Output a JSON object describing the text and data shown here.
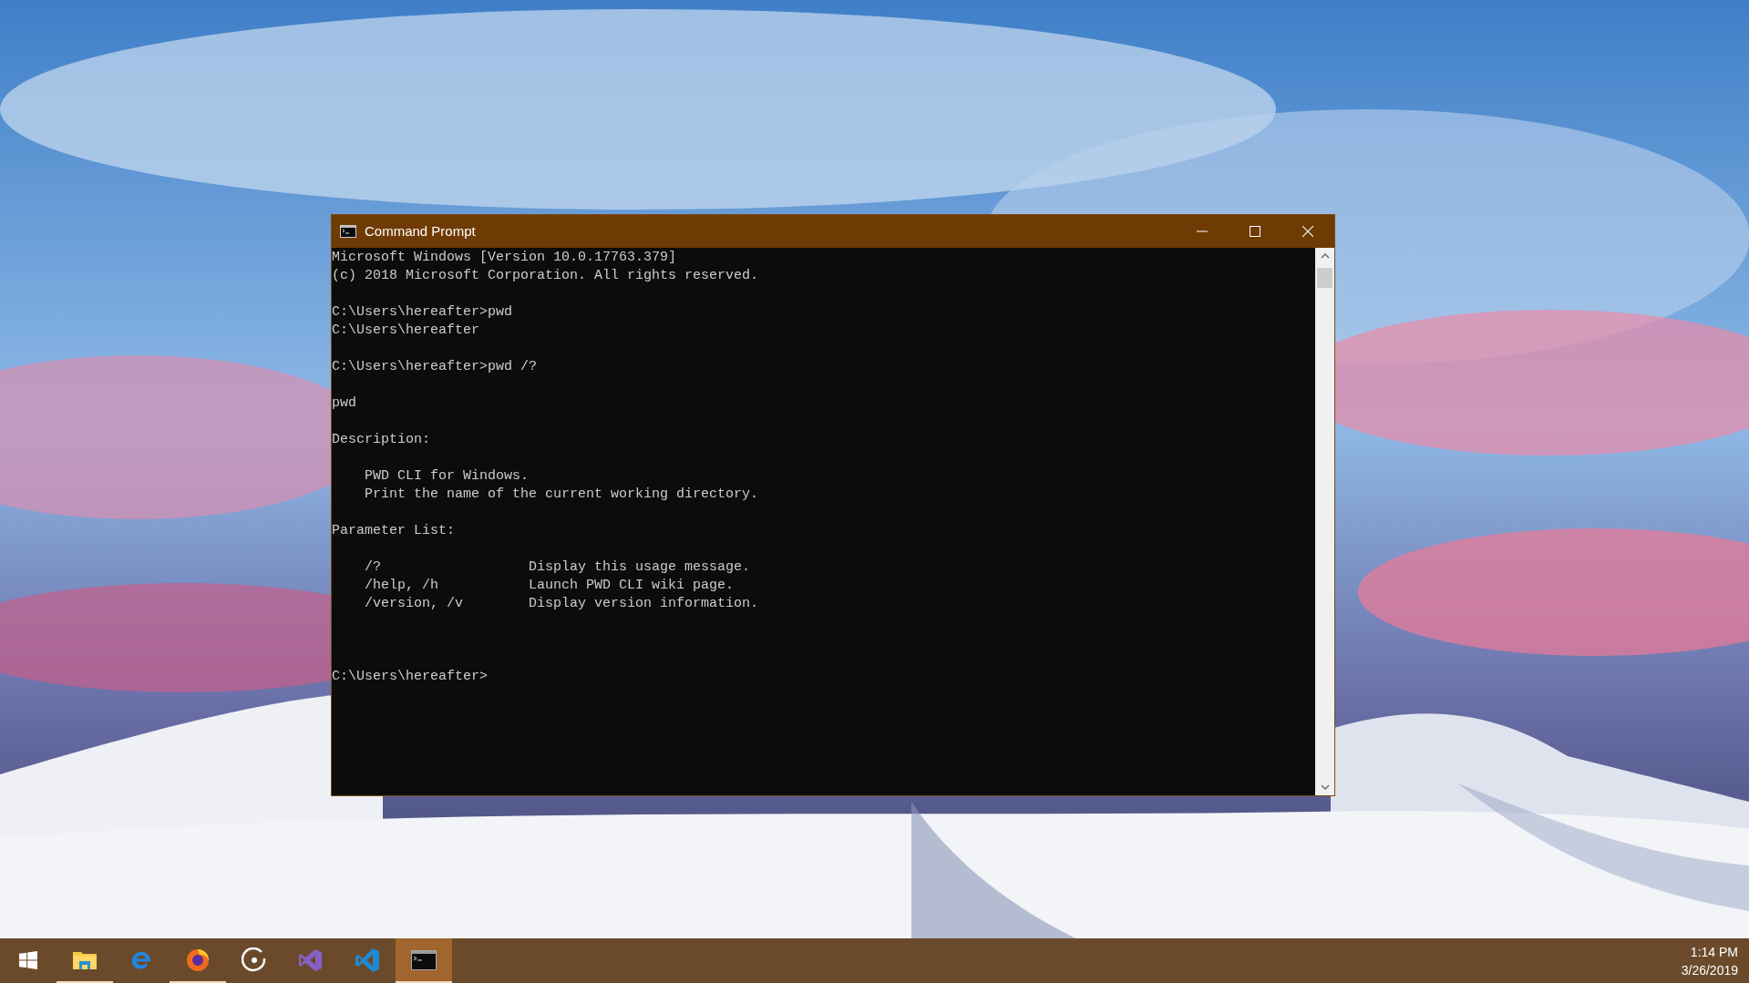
{
  "window": {
    "title": "Command Prompt",
    "active": true
  },
  "console": {
    "lines": [
      {
        "kind": "line",
        "text": "Microsoft Windows [Version 10.0.17763.379]"
      },
      {
        "kind": "line",
        "text": "(c) 2018 Microsoft Corporation. All rights reserved."
      },
      {
        "kind": "blank"
      },
      {
        "kind": "line",
        "text": "C:\\Users\\hereafter>pwd"
      },
      {
        "kind": "line",
        "text": "C:\\Users\\hereafter"
      },
      {
        "kind": "blank"
      },
      {
        "kind": "line",
        "text": "C:\\Users\\hereafter>pwd /?"
      },
      {
        "kind": "blank"
      },
      {
        "kind": "line",
        "text": "pwd"
      },
      {
        "kind": "blank"
      },
      {
        "kind": "line",
        "text": "Description:"
      },
      {
        "kind": "blank"
      },
      {
        "kind": "indented",
        "text": "PWD CLI for Windows."
      },
      {
        "kind": "indented",
        "text": "Print the name of the current working directory."
      },
      {
        "kind": "blank"
      },
      {
        "kind": "line",
        "text": "Parameter List:"
      },
      {
        "kind": "blank"
      },
      {
        "kind": "param",
        "option": "/?",
        "description": "Display this usage message."
      },
      {
        "kind": "param",
        "option": "/help, /h",
        "description": "Launch PWD CLI wiki page."
      },
      {
        "kind": "param",
        "option": "/version, /v",
        "description": "Display version information."
      },
      {
        "kind": "blank"
      },
      {
        "kind": "blank"
      },
      {
        "kind": "blank"
      },
      {
        "kind": "line",
        "text": "C:\\Users\\hereafter>"
      }
    ]
  },
  "taskbar": {
    "items": [
      {
        "kind": "start",
        "running": false,
        "selected": false
      },
      {
        "kind": "folder",
        "running": true,
        "selected": false
      },
      {
        "kind": "edge",
        "running": false,
        "selected": false
      },
      {
        "kind": "firefox",
        "running": true,
        "selected": false
      },
      {
        "kind": "groove",
        "running": false,
        "selected": false
      },
      {
        "kind": "vs",
        "running": false,
        "selected": false
      },
      {
        "kind": "vscode",
        "running": false,
        "selected": false
      },
      {
        "kind": "terminal",
        "running": true,
        "selected": true
      }
    ],
    "clock": {
      "time": "1:14 PM",
      "date": "3/26/2019"
    }
  }
}
